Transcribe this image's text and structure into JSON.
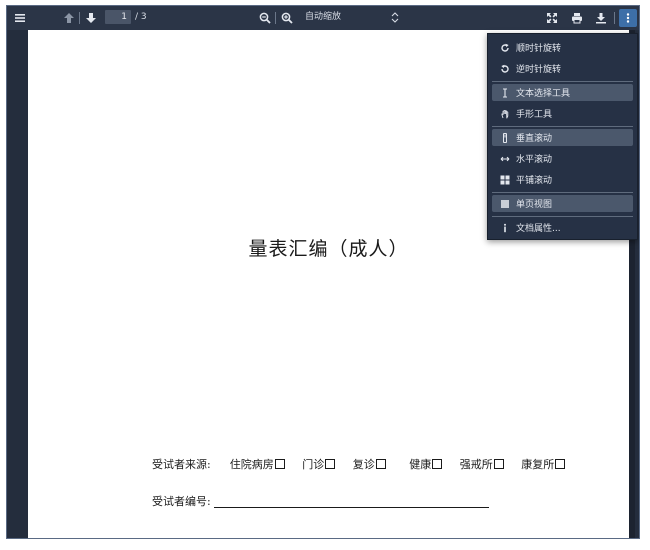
{
  "toolbar": {
    "page_number": "1",
    "page_total": "/ 3",
    "zoom_label": "自动缩放"
  },
  "document": {
    "title": "量表汇编（成人）",
    "source_label": "受试者来源:",
    "source_options": [
      "住院病房",
      "门诊",
      "复诊",
      "健康",
      "强戒所",
      "康复所"
    ],
    "number_label": "受试者编号:"
  },
  "menu": {
    "items": [
      {
        "label": "顺时针旋转",
        "icon": "rotate-cw-icon"
      },
      {
        "label": "逆时针旋转",
        "icon": "rotate-ccw-icon"
      },
      {
        "label": "文本选择工具",
        "icon": "text-cursor-icon"
      },
      {
        "label": "手形工具",
        "icon": "hand-icon"
      },
      {
        "label": "垂直滚动",
        "icon": "vertical-scroll-icon"
      },
      {
        "label": "水平滚动",
        "icon": "horizontal-scroll-icon"
      },
      {
        "label": "平铺滚动",
        "icon": "wrapped-scroll-icon"
      },
      {
        "label": "单页视图",
        "icon": "single-page-icon"
      },
      {
        "label": "文档属性...",
        "icon": "info-icon"
      }
    ]
  },
  "colors": {
    "toolbar_bg": "#2b3547",
    "menu_bg": "#263145",
    "selected_bg": "#4b586c",
    "active_button": "#3d6fa8"
  }
}
